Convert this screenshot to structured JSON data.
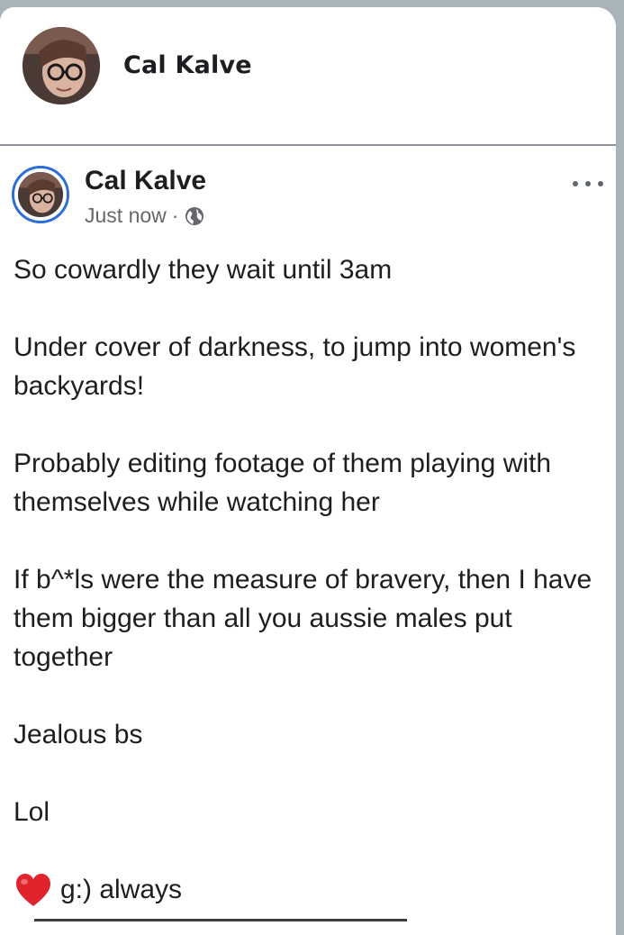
{
  "header": {
    "name": "Cal Kalve"
  },
  "post": {
    "author": "Cal Kalve",
    "timestamp": "Just now",
    "separator": "·",
    "privacy_icon": "globe-icon",
    "more_icon": "more-options-icon",
    "paragraphs": [
      "So cowardly they wait until 3am",
      "Under cover of darkness, to jump into women's backyards!",
      "Probably editing footage of them playing with themselves while watching her",
      "If b^*ls were the measure of bravery, then I have them bigger than all you aussie males put together",
      "Jealous bs",
      "Lol"
    ],
    "last_line": "g:) always",
    "last_line_icon": "red-heart-icon"
  },
  "colors": {
    "accent_ring": "#2d6fd6",
    "text": "#1c1e21",
    "meta": "#65676b",
    "heart": "#e0242e"
  }
}
